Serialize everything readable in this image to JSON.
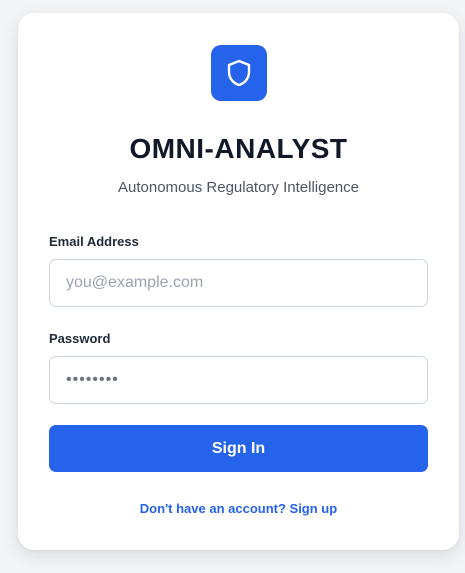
{
  "app": {
    "title": "OMNI-ANALYST",
    "subtitle": "Autonomous Regulatory Intelligence",
    "logo_icon": "shield-icon"
  },
  "form": {
    "email_label": "Email Address",
    "email_placeholder": "you@example.com",
    "email_value": "",
    "password_label": "Password",
    "password_placeholder": "••••••••",
    "password_value": "",
    "submit_label": "Sign In",
    "signup_link": "Don't have an account? Sign up"
  },
  "colors": {
    "accent": "#2563eb",
    "title": "#111827",
    "background": "#f3f4f6"
  }
}
